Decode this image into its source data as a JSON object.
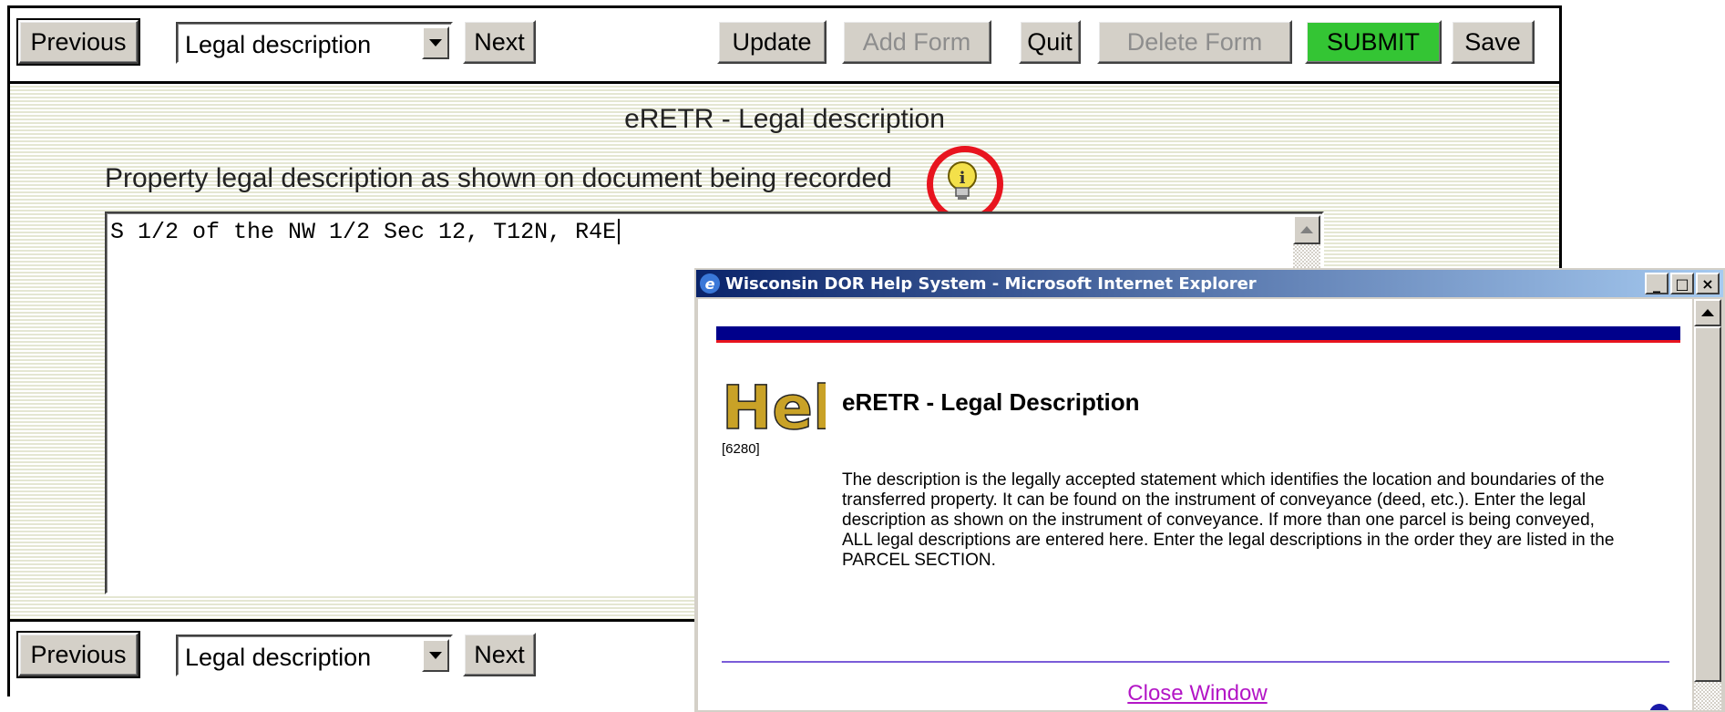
{
  "toolbar_top": {
    "previous_label": "Previous",
    "select_value": "Legal description",
    "next_label": "Next",
    "update_label": "Update",
    "add_form_label": "Add Form",
    "quit_label": "Quit",
    "delete_form_label": "Delete Form",
    "submit_label": "SUBMIT",
    "save_label": "Save"
  },
  "form": {
    "title": "eRETR - Legal description",
    "prompt": "Property legal description as shown on document being recorded",
    "legal_description_value": "S 1/2 of the NW 1/2 Sec 12, T12N, R4E"
  },
  "toolbar_bottom": {
    "previous_label": "Previous",
    "select_value": "Legal description",
    "next_label": "Next"
  },
  "popup": {
    "window_title": "Wisconsin DOR Help System - Microsoft Internet Explorer",
    "minimize": "_",
    "maximize": "□",
    "close": "×",
    "logo_text": "Help",
    "heading": "eRETR - Legal Description",
    "id_text": "[6280]",
    "body_text": "The description is the legally accepted statement which identifies the location and boundaries of the transferred property.  It can be found on the instrument of conveyance (deed, etc.).  Enter the legal description as shown on the instrument of conveyance.  If more than one parcel is being conveyed, ALL legal descriptions are entered here.  Enter the legal descriptions in the order they are listed in the PARCEL SECTION.",
    "close_link": "Close Window"
  },
  "colors": {
    "submit_green": "#34c534",
    "highlight_red": "#e8141e",
    "help_navy": "#00008b",
    "link_purple": "#b316c6"
  },
  "icons": {
    "info": "lightbulb-info-icon",
    "dropdown": "chevron-down-icon",
    "ie": "internet-explorer-icon"
  }
}
